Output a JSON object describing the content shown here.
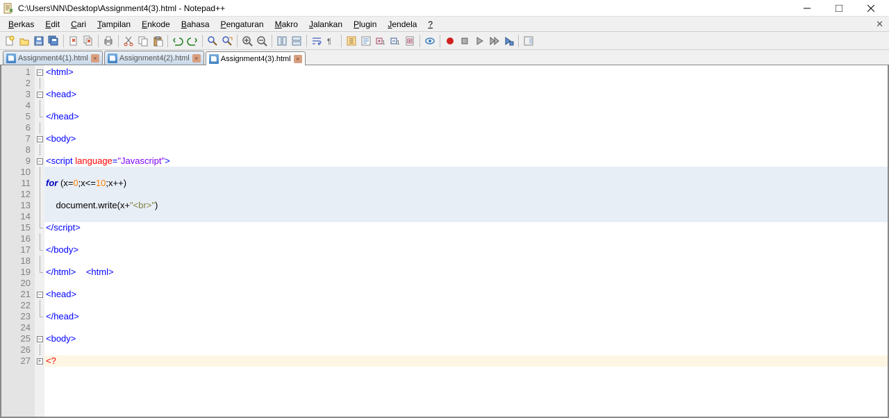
{
  "window": {
    "title": "C:\\Users\\NN\\Desktop\\Assignment4(3).html - Notepad++"
  },
  "menu": {
    "items": [
      "Berkas",
      "Edit",
      "Cari",
      "Tampilan",
      "Enkode",
      "Bahasa",
      "Pengaturan",
      "Makro",
      "Jalankan",
      "Plugin",
      "Jendela",
      "?"
    ]
  },
  "tabs": {
    "items": [
      {
        "label": "Assignment4(1).html",
        "active": false
      },
      {
        "label": "Assignment4(2).html",
        "active": false
      },
      {
        "label": "Assignment4(3).html",
        "active": true
      }
    ]
  },
  "code": {
    "lines": [
      {
        "n": 1,
        "fold": "box-minus",
        "html": "<span class='t-tag'>&lt;html&gt;</span>"
      },
      {
        "n": 2,
        "fold": "vline",
        "html": ""
      },
      {
        "n": 3,
        "fold": "box-minus",
        "html": "<span class='t-tag'>&lt;head&gt;</span>"
      },
      {
        "n": 4,
        "fold": "vline",
        "html": ""
      },
      {
        "n": 5,
        "fold": "endline",
        "html": "<span class='t-tag'>&lt;/head&gt;</span>"
      },
      {
        "n": 6,
        "fold": "vline",
        "html": ""
      },
      {
        "n": 7,
        "fold": "box-minus",
        "html": "<span class='t-tag'>&lt;body&gt;</span>"
      },
      {
        "n": 8,
        "fold": "vline",
        "html": ""
      },
      {
        "n": 9,
        "fold": "box-minus",
        "html": "<span class='t-tag'>&lt;script</span> <span class='t-attr'>language</span><span class='t-tag'>=</span><span class='t-str'>\"Javascript\"</span><span class='t-tag'>&gt;</span>"
      },
      {
        "n": 10,
        "fold": "vline",
        "html": "",
        "hl": true
      },
      {
        "n": 11,
        "fold": "vline",
        "html": "<span class='t-kw'>for</span> <span class='t-nm'>(x</span><span class='t-nm'>=</span><span class='t-num'>0</span><span class='t-nm'>;x&lt;=</span><span class='t-num'>10</span><span class='t-nm'>;x++)</span>",
        "hl": true
      },
      {
        "n": 12,
        "fold": "vline",
        "html": "",
        "hl": true
      },
      {
        "n": 13,
        "fold": "vline",
        "html": "    <span class='t-nm'>document.</span><span class='t-fn'>write</span><span class='t-nm'>(x+</span><span class='t-embed'>\"&lt;br&gt;\"</span><span class='t-nm'>)</span>",
        "hl": true
      },
      {
        "n": 14,
        "fold": "vline",
        "html": "",
        "hl": true
      },
      {
        "n": 15,
        "fold": "endline",
        "html": "<span class='t-tag'>&lt;/script&gt;</span>"
      },
      {
        "n": 16,
        "fold": "vline",
        "html": ""
      },
      {
        "n": 17,
        "fold": "endline",
        "html": "<span class='t-tag'>&lt;/body&gt;</span>"
      },
      {
        "n": 18,
        "fold": "vline",
        "html": ""
      },
      {
        "n": 19,
        "fold": "endline",
        "html": "<span class='t-tag'>&lt;/html&gt;</span>    <span class='t-tag'>&lt;html&gt;</span>"
      },
      {
        "n": 20,
        "fold": "",
        "html": ""
      },
      {
        "n": 21,
        "fold": "box-minus",
        "html": "<span class='t-tag'>&lt;head&gt;</span>"
      },
      {
        "n": 22,
        "fold": "vline",
        "html": ""
      },
      {
        "n": 23,
        "fold": "endline",
        "html": "<span class='t-tag'>&lt;/head&gt;</span>"
      },
      {
        "n": 24,
        "fold": "",
        "html": ""
      },
      {
        "n": 25,
        "fold": "box-minus",
        "html": "<span class='t-tag'>&lt;body&gt;</span>"
      },
      {
        "n": 26,
        "fold": "vline",
        "html": ""
      },
      {
        "n": 27,
        "fold": "box-plus",
        "html": "<span class='t-err'>&lt;?</span>",
        "caret": true
      }
    ]
  },
  "toolbar_icons": [
    "new-file",
    "open-file",
    "save-file",
    "save-all",
    "sep",
    "close-file",
    "close-all",
    "sep",
    "print",
    "sep",
    "cut",
    "copy",
    "paste",
    "sep",
    "undo",
    "redo",
    "sep",
    "find",
    "replace",
    "sep",
    "zoom-in",
    "zoom-out",
    "sep",
    "sync-v",
    "sync-h",
    "sep",
    "word-wrap",
    "show-all",
    "sep",
    "indent-guide",
    "udf",
    "fold-level",
    "unfold-level",
    "fold-doc",
    "sep",
    "hide-lines",
    "sep",
    "record-macro",
    "stop-macro",
    "play-macro",
    "play-multi",
    "save-macro",
    "sep",
    "doc-map"
  ]
}
